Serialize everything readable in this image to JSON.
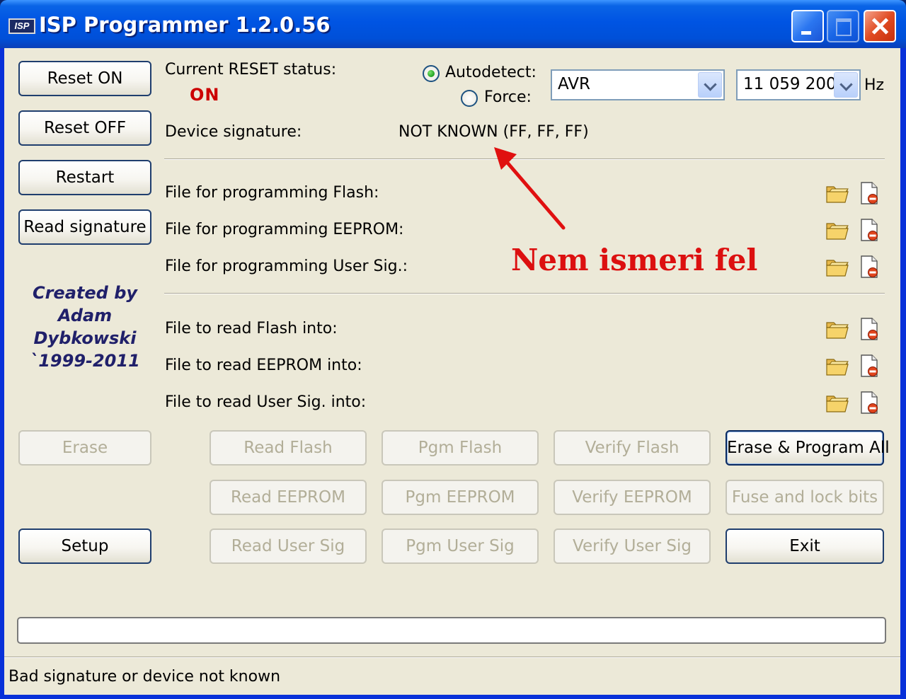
{
  "window": {
    "title": "ISP Programmer 1.2.0.56",
    "app_icon_text": "ISP"
  },
  "reset_buttons": {
    "reset_on": "Reset ON",
    "reset_off": "Reset OFF",
    "restart": "Restart",
    "read_signature": "Read signature"
  },
  "status": {
    "reset_label": "Current RESET status:",
    "reset_value": "ON",
    "device_signature_label": "Device signature:",
    "device_signature_value": "NOT KNOWN (FF, FF, FF)"
  },
  "detection": {
    "autodetect_label": "Autodetect:",
    "force_label": "Force:",
    "selected": "autodetect",
    "device_family": "AVR",
    "frequency": "11 059 200",
    "frequency_unit": "Hz"
  },
  "credit": {
    "lines": [
      "Created by",
      "Adam",
      "Dybkowski",
      "`1999-2011"
    ]
  },
  "program_files": [
    "File for programming Flash:",
    "File for programming EEPROM:",
    "File for programming User Sig.:"
  ],
  "read_files": [
    "File to read Flash into:",
    "File to read EEPROM into:",
    "File to read User Sig. into:"
  ],
  "annotation": "Nem ismeri fel",
  "actions": {
    "erase": "Erase",
    "read_flash": "Read Flash",
    "pgm_flash": "Pgm Flash",
    "verify_flash": "Verify Flash",
    "erase_program_all": "Erase & Program All",
    "read_eeprom": "Read EEPROM",
    "pgm_eeprom": "Pgm EEPROM",
    "verify_eeprom": "Verify EEPROM",
    "fuse_lock_bits": "Fuse and lock bits",
    "setup": "Setup",
    "read_user_sig": "Read User Sig",
    "pgm_user_sig": "Pgm User Sig",
    "verify_user_sig": "Verify User Sig",
    "exit": "Exit"
  },
  "progress": {
    "value": 0
  },
  "statusbar": {
    "text": "Bad signature or device not known"
  },
  "colors": {
    "title_bar": "#0054e3",
    "client_bg": "#ece9d8",
    "reset_status": "#cc0000",
    "credit_text": "#20206a",
    "annotation": "#dc1010"
  },
  "icons": {
    "open": "folder-open-icon",
    "clear": "clear-file-icon"
  }
}
